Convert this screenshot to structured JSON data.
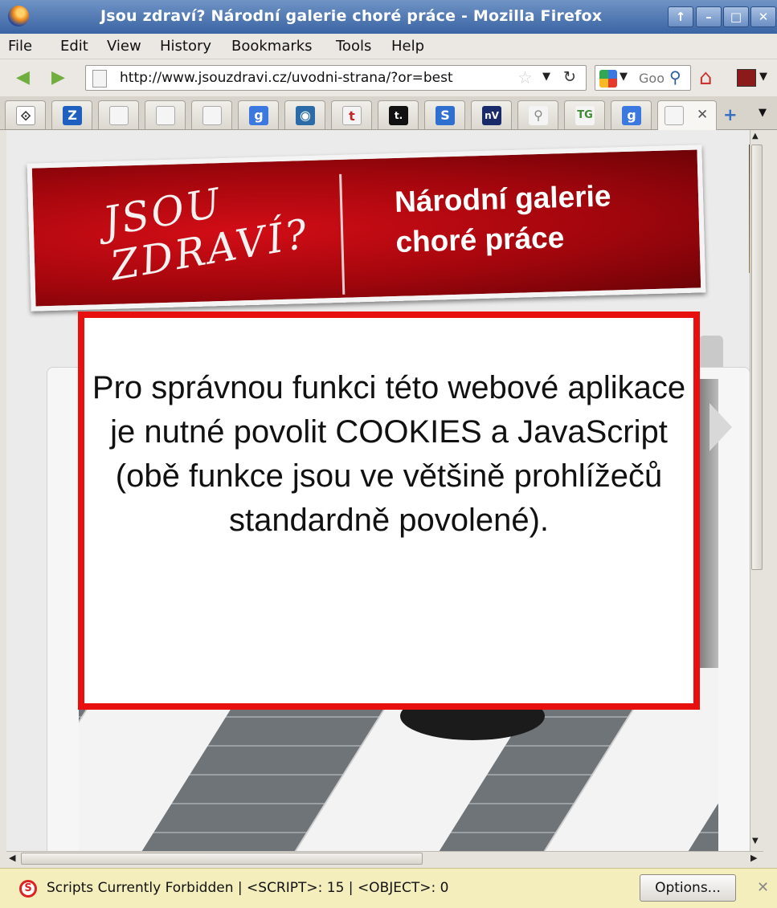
{
  "window": {
    "title": "Jsou zdraví? Národní galerie choré práce - Mozilla Firefox",
    "controls": [
      "↑",
      "–",
      "□",
      "✕"
    ]
  },
  "menu": {
    "items": [
      "File",
      "Edit",
      "View",
      "History",
      "Bookmarks",
      "Tools",
      "Help"
    ]
  },
  "nav": {
    "back_icon": "back-arrow-icon",
    "forward_icon": "forward-arrow-icon",
    "url": "http://www.jsouzdravi.cz/uvodni-strana/?or=best",
    "search_placeholder": "Goo",
    "home_icon": "home-icon"
  },
  "tabs": {
    "items": [
      {
        "icon": "⟐",
        "bg": "#ffffff",
        "fg": "#333333"
      },
      {
        "icon": "Z",
        "bg": "#1f5fbf",
        "fg": "#ffffff"
      },
      {
        "icon": "",
        "bg": "#f5f5f5",
        "fg": "#999999"
      },
      {
        "icon": "",
        "bg": "#f5f5f5",
        "fg": "#999999"
      },
      {
        "icon": "",
        "bg": "#f5f5f5",
        "fg": "#999999"
      },
      {
        "icon": "g",
        "bg": "#3b79e0",
        "fg": "#ffffff"
      },
      {
        "icon": "◉",
        "bg": "#2b6ca8",
        "fg": "#ffffff"
      },
      {
        "icon": "t",
        "bg": "#f4f4f4",
        "fg": "#c1272d"
      },
      {
        "icon": "t.",
        "bg": "#111111",
        "fg": "#ffffff"
      },
      {
        "icon": "S",
        "bg": "#2f6fcf",
        "fg": "#ffffff"
      },
      {
        "icon": "nV",
        "bg": "#1a2b6a",
        "fg": "#ffffff"
      },
      {
        "icon": "⚲",
        "bg": "#f4f4f4",
        "fg": "#888888"
      },
      {
        "icon": "TG",
        "bg": "#f4f4f4",
        "fg": "#3d8b2f"
      },
      {
        "icon": "g",
        "bg": "#3b79e0",
        "fg": "#ffffff"
      }
    ],
    "active_close": "✕",
    "new_tab": "+",
    "list": "▼"
  },
  "banner": {
    "logo_text": "JSOU\nZDRAVÍ?",
    "slogan": "Národní galerie choré práce"
  },
  "notice": {
    "text": "Pro správnou funkci této webové aplikace je nutné povolit COOKIES a JavaScript (obě funkce jsou ve většině prohlížečů standardně povolené)."
  },
  "statusbar": {
    "message": "Scripts Currently Forbidden | <SCRIPT>: 15 | <OBJECT>: 0",
    "options_label": "Options...",
    "close": "✕"
  },
  "colors": {
    "notice_border": "#e80f0f",
    "banner_red": "#b5070e",
    "statusbar_bg": "#f4eebc"
  }
}
